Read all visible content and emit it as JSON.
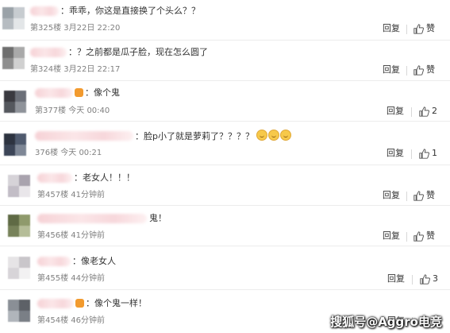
{
  "comments": [
    {
      "text": "：乖乖，你这是直接换了个头么？？",
      "meta": "第325楼 3月22日 22:20",
      "reply": "回复",
      "like": "赞",
      "avatar_colors": [
        "#9aa2a8",
        "#c7ccd0",
        "#b6bcc1",
        "#e3e6e8"
      ]
    },
    {
      "text": "：？之前都是瓜子脸，现在怎么圆了",
      "meta": "第324楼 3月22日 22:17",
      "reply": "回复",
      "like": "赞",
      "avatar_colors": [
        "#6f6f6f",
        "#a9a9a9",
        "#8e8e8e",
        "#d0d0d0"
      ]
    },
    {
      "text": "：像个鬼",
      "meta": "第377楼 今天 00:40",
      "reply": "回复",
      "like": "2",
      "avatar_colors": [
        "#3a3a40",
        "#6b6f78",
        "#55585e",
        "#8f939a"
      ]
    },
    {
      "text": "：脸p小了就是萝莉了？？？？",
      "meta": "376楼 今天 00:21",
      "reply": "回复",
      "like": "1",
      "avatar_colors": [
        "#2d3340",
        "#4f5a6e",
        "#3c4557",
        "#7e8796"
      ]
    },
    {
      "text": "：老女人！！！",
      "meta": "第457楼 41分钟前",
      "reply": "回复",
      "like": "赞",
      "avatar_colors": [
        "#d6d3d8",
        "#a9a3ae",
        "#c2bdc6",
        "#e9e6ea"
      ]
    },
    {
      "text": "鬼！",
      "meta": "第456楼 41分钟前",
      "reply": "回复",
      "like": "赞",
      "avatar_colors": [
        "#5f6a45",
        "#8f9a6c",
        "#77825a",
        "#b5bd98"
      ]
    },
    {
      "text": "：像老女人",
      "meta": "第455楼 44分钟前",
      "reply": "回复",
      "like": "3",
      "avatar_colors": [
        "#e6e4e6",
        "#c9c6ca",
        "#d7d4d8",
        "#f2f1f2"
      ]
    },
    {
      "text": "：像个鬼一样！",
      "meta": "第454楼 46分钟前",
      "reply": "回复",
      "like": "赞",
      "avatar_colors": [
        "#8a8f96",
        "#5d6167",
        "#b0b5bb",
        "#7a7f86"
      ]
    }
  ],
  "watermark": "搜狐号@Aggro电竞",
  "icons": {
    "like": "thumbs-up-icon",
    "emoji": "smiley-emoji-icon",
    "badge": "vip-badge-icon"
  },
  "colors": {
    "text": "#333333",
    "meta": "#808080",
    "divider": "#ececec"
  }
}
